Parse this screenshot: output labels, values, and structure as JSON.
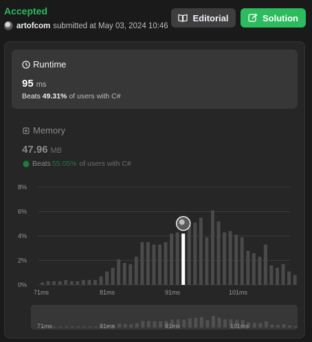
{
  "header": {
    "status": "Accepted",
    "user": "artofcom",
    "submitted_text": "submitted at May 03, 2024 10:46",
    "editorial_label": "Editorial",
    "solution_label": "Solution"
  },
  "runtime": {
    "title": "Runtime",
    "value": "95",
    "unit": "ms",
    "beats_label": "Beats",
    "beats_pct": "49.31%",
    "beats_rest": "of users with C#"
  },
  "memory": {
    "title": "Memory",
    "value": "47.96",
    "unit": "MB",
    "beats_label": "Beats",
    "beats_pct": "55.05%",
    "beats_rest": "of users with C#"
  },
  "colors": {
    "accent_green": "#2cbb5d",
    "bar": "#4a4a4a",
    "highlight_bar": "#ffffff"
  },
  "chart_data": {
    "type": "bar",
    "y_ticks": [
      "8%",
      "6%",
      "4%",
      "2%",
      "0%"
    ],
    "ylim": [
      0,
      8
    ],
    "x_tick_labels": [
      "71ms",
      "81ms",
      "91ms",
      "101ms"
    ],
    "x": [
      71,
      72,
      73,
      74,
      75,
      76,
      77,
      78,
      79,
      80,
      81,
      82,
      83,
      84,
      85,
      86,
      87,
      88,
      89,
      90,
      91,
      92,
      93,
      94,
      95,
      96,
      97,
      98,
      99,
      100,
      101,
      102,
      103,
      104,
      105,
      106,
      107,
      108,
      109,
      110
    ],
    "values": [
      0.2,
      0.3,
      0.3,
      0.3,
      0.4,
      0.3,
      0.3,
      0.4,
      0.4,
      0.4,
      0.7,
      1.1,
      1.4,
      2.1,
      1.8,
      1.7,
      2.3,
      3.5,
      3.5,
      3.3,
      3.3,
      3.5,
      4.2,
      4.3,
      4.2,
      4.9,
      5.1,
      5.5,
      3.9,
      6.1,
      5.2,
      4.3,
      4.4,
      4.1,
      3.9,
      2.8,
      2.6,
      2.3,
      3.3,
      1.6,
      1.4,
      1.7,
      1.1,
      0.8
    ],
    "selected_x": 95,
    "selected_value": 3.9,
    "mini_x_tick_labels": [
      "71ms",
      "81ms",
      "91ms",
      "101ms"
    ]
  }
}
